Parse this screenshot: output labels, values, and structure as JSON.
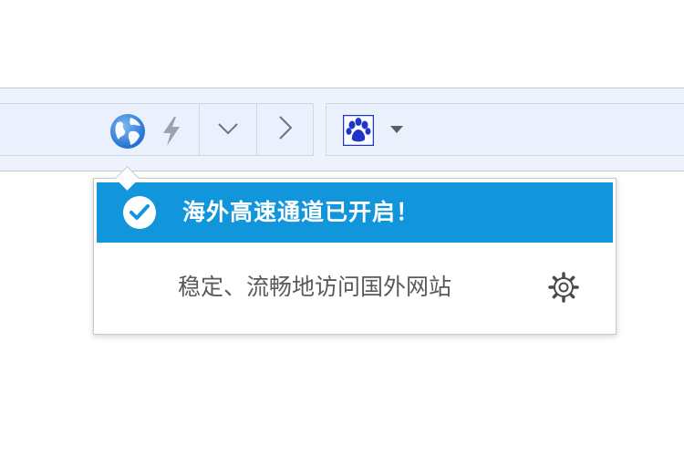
{
  "toolbar": {
    "globe_icon": "globe-icon",
    "bolt_icon": "lightning-icon",
    "dropdown_icon": "chevron-down-icon",
    "forward_icon": "chevron-right-icon",
    "search_engine_icon": "baidu-paw-icon"
  },
  "popup": {
    "title": "海外高速通道已开启！",
    "subtitle": "稳定、流畅地访问国外网站",
    "status_icon": "check-circle-icon",
    "settings_icon": "gear-icon"
  },
  "colors": {
    "header_background": "#1296db",
    "toolbar_background": "#eef3fb",
    "globe_blue": "#2b78d4",
    "paw_blue": "#1f34c8"
  }
}
